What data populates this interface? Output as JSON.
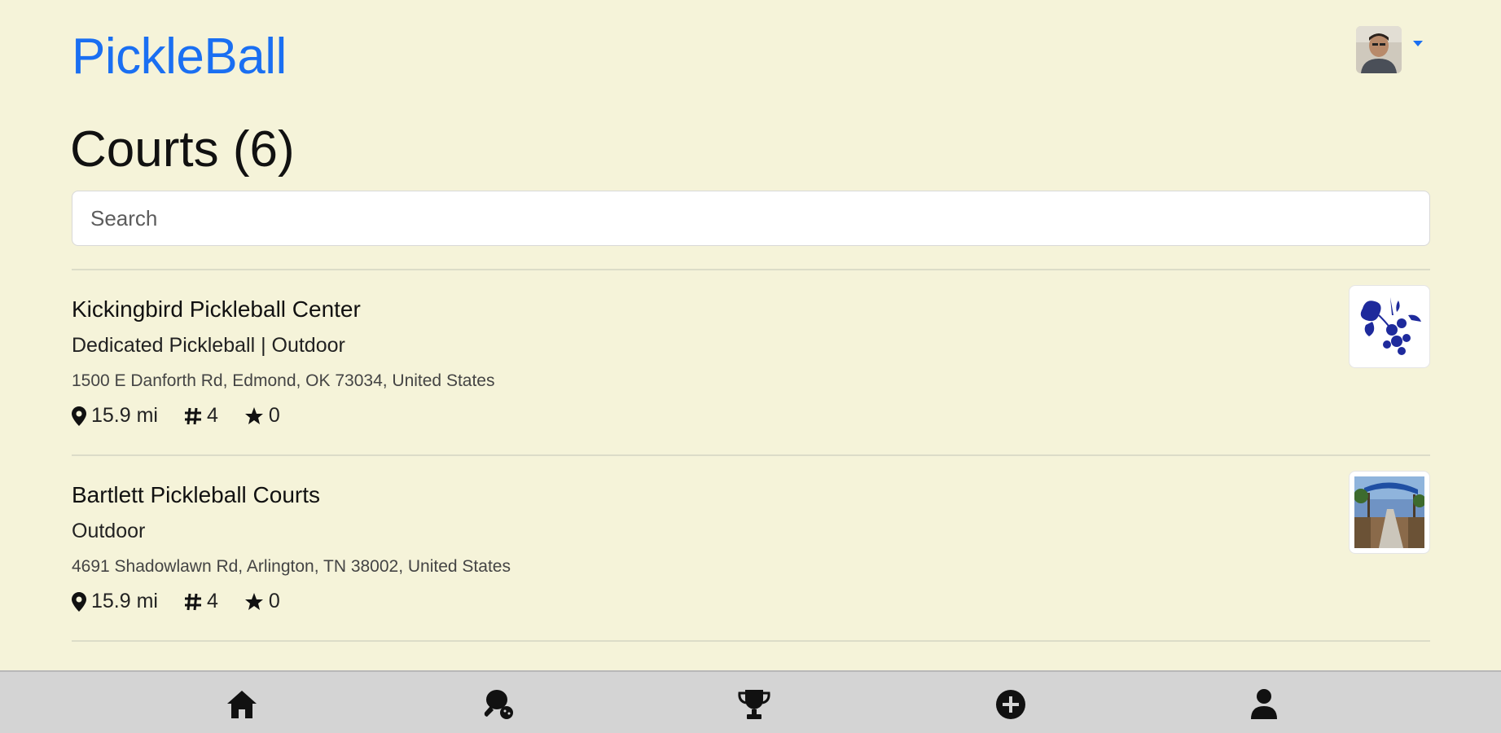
{
  "app": {
    "brand": "PickleBall"
  },
  "page": {
    "title": "Courts (6)"
  },
  "search": {
    "placeholder": "Search",
    "value": ""
  },
  "courts": [
    {
      "name": "Kickingbird Pickleball Center",
      "type": "Dedicated Pickleball | Outdoor",
      "address": "1500 E Danforth Rd, Edmond, OK 73034, United States",
      "distance": "15.9 mi",
      "court_count": "4",
      "rating": "0",
      "thumbnail": "blue-floral-logo"
    },
    {
      "name": "Bartlett Pickleball Courts",
      "type": "Outdoor",
      "address": "4691 Shadowlawn Rd, Arlington, TN 38002, United States",
      "distance": "15.9 mi",
      "court_count": "4",
      "rating": "0",
      "thumbnail": "court-photo"
    }
  ],
  "bottom_nav": [
    {
      "icon": "home-icon"
    },
    {
      "icon": "pickleball-paddle-icon"
    },
    {
      "icon": "trophy-icon"
    },
    {
      "icon": "plus-circle-icon"
    },
    {
      "icon": "user-icon"
    }
  ],
  "colors": {
    "background": "#f5f3d9",
    "brand": "#1a6ff2",
    "nav_bar": "#d4d4d4"
  }
}
